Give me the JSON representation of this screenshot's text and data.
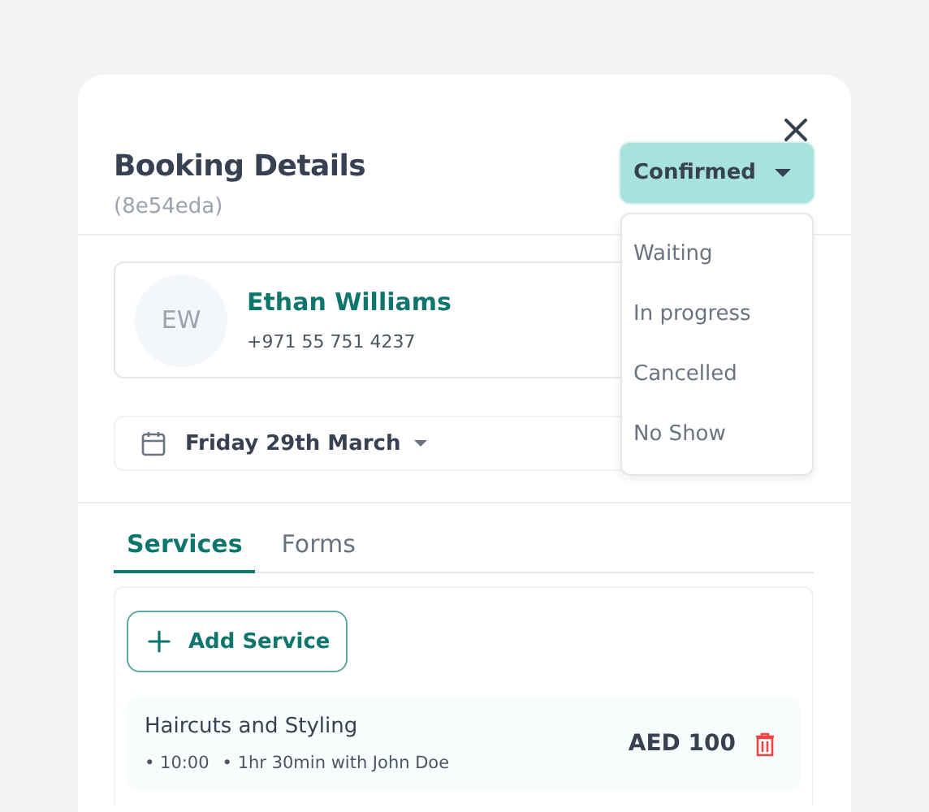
{
  "dialog": {
    "title": "Booking Details",
    "booking_id": "(8e54eda)"
  },
  "status": {
    "value": "Confirmed",
    "expanded": true,
    "options": [
      "Waiting",
      "In progress",
      "Cancelled",
      "No Show"
    ]
  },
  "customer": {
    "initials": "EW",
    "name": "Ethan Williams",
    "phone": "+971 55 751 4237"
  },
  "date": {
    "label": "Friday 29th March"
  },
  "tabs": [
    {
      "label": "Services",
      "selected": true
    },
    {
      "label": "Forms",
      "selected": false
    }
  ],
  "add_button": "Add Service",
  "services": [
    {
      "name": "Haircuts and Styling",
      "time": "• 10:00",
      "detail": "• 1hr 30min with John Doe",
      "price": "AED 100"
    }
  ]
}
